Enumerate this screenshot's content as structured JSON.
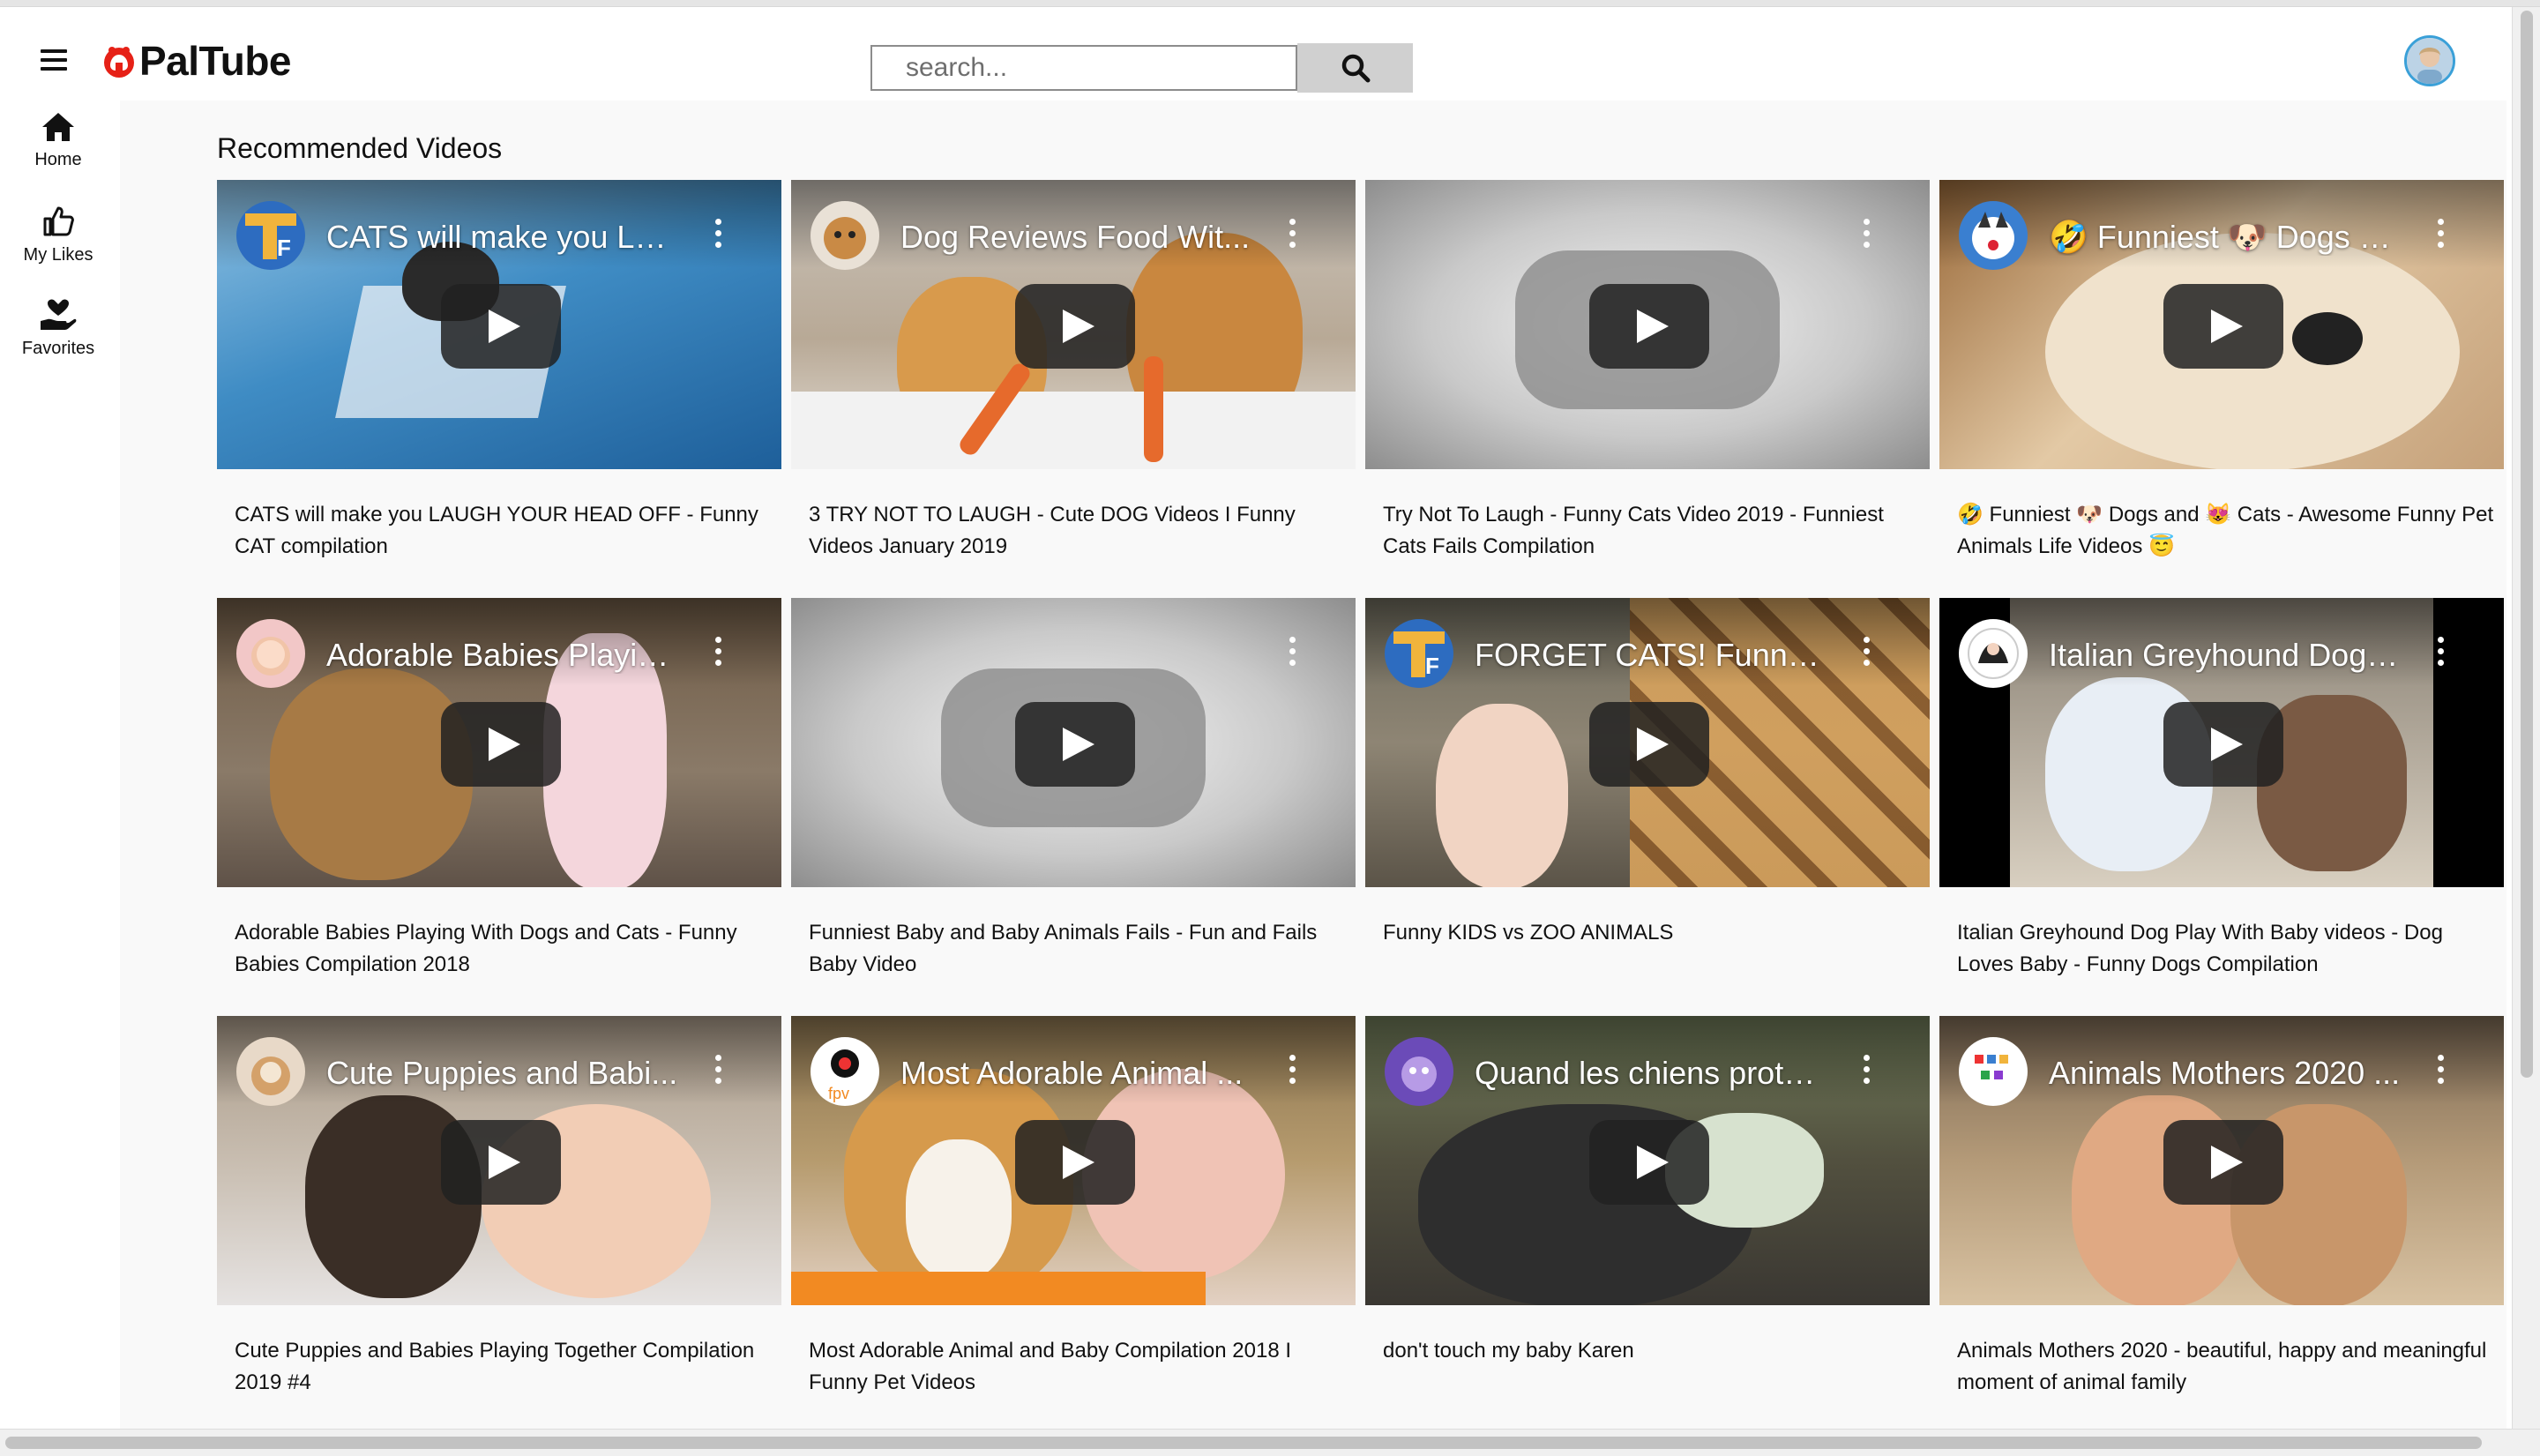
{
  "app": {
    "name": "PalTube",
    "accent": "#e62117"
  },
  "search": {
    "placeholder": "search..."
  },
  "sidebar": {
    "items": [
      {
        "label": "Home",
        "icon": "home-icon"
      },
      {
        "label": "My Likes",
        "icon": "thumbs-up-icon"
      },
      {
        "label": "Favorites",
        "icon": "heart-hand-icon"
      }
    ]
  },
  "main": {
    "section_title": "Recommended Videos",
    "videos": [
      {
        "overlay_title": "CATS will make you LA...",
        "title": "CATS will make you LAUGH YOUR HEAD OFF - Funny CAT compilation"
      },
      {
        "overlay_title": "Dog Reviews Food Wit...",
        "title": "3 TRY NOT TO LAUGH - Cute DOG Videos I Funny Videos January 2019"
      },
      {
        "overlay_title": "",
        "title": "Try Not To Laugh - Funny Cats Video 2019 - Funniest Cats Fails Compilation"
      },
      {
        "overlay_title": "🤣 Funniest 🐶 Dogs a...",
        "title": "🤣 Funniest 🐶 Dogs and 😻 Cats - Awesome Funny Pet Animals Life Videos 😇"
      },
      {
        "overlay_title": "Adorable Babies Playin...",
        "title": "Adorable Babies Playing With Dogs and Cats - Funny Babies Compilation 2018"
      },
      {
        "overlay_title": "",
        "title": "Funniest Baby and Baby Animals Fails - Fun and Fails Baby Video"
      },
      {
        "overlay_title": "FORGET CATS! Funny ...",
        "title": "Funny KIDS vs ZOO ANIMALS"
      },
      {
        "overlay_title": "Italian Greyhound Dog ...",
        "title": "Italian Greyhound Dog Play With Baby videos - Dog Loves Baby - Funny Dogs Compilation"
      },
      {
        "overlay_title": "Cute Puppies and Babi...",
        "title": "Cute Puppies and Babies Playing Together Compilation 2019 #4"
      },
      {
        "overlay_title": "Most Adorable Animal ...",
        "title": "Most Adorable Animal and Baby Compilation 2018 I Funny Pet Videos"
      },
      {
        "overlay_title": "Quand les chiens protè...",
        "title": "don't touch my baby Karen"
      },
      {
        "overlay_title": "Animals Mothers 2020 ...",
        "title": "Animals Mothers 2020 - beautiful, happy and meaningful moment of animal family"
      }
    ]
  }
}
